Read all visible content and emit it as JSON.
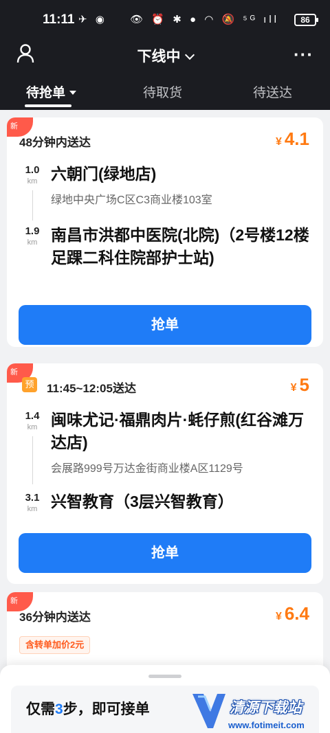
{
  "status_bar": {
    "time": "11:11",
    "left_icons": "✈ ◉",
    "right_icons": "👁 ⏰ ✱ ● ◠ 🔕 ⁵ᴳ ıll",
    "battery": "86"
  },
  "header": {
    "title": "下线中",
    "icons": [
      "user-icon",
      "chevron-down-icon",
      "more-icon"
    ],
    "more": "···"
  },
  "tabs": [
    {
      "label": "待抢单",
      "active": true
    },
    {
      "label": "待取货",
      "active": false
    },
    {
      "label": "待送达",
      "active": false
    }
  ],
  "orders": [
    {
      "badge": "新",
      "eta": "48分钟内送达",
      "currency": "¥",
      "price": "4.1",
      "pickup": {
        "distance": "1.0",
        "unit": "km",
        "name": "六朝门(绿地店)",
        "address": "绿地中央广场C区C3商业楼103室"
      },
      "dropoff": {
        "distance": "1.9",
        "unit": "km",
        "name": "南昌市洪都中医院(北院)（2号楼12楼足踝二科住院部护士站)"
      },
      "button": "抢单"
    },
    {
      "badge": "新",
      "tag": "预",
      "eta": "11:45~12:05送达",
      "currency": "¥",
      "price": "5",
      "pickup": {
        "distance": "1.4",
        "unit": "km",
        "name": "闽味尤记·福鼎肉片·蚝仔煎(红谷滩万达店)",
        "address": "会展路999号万达金街商业楼A区1129号"
      },
      "dropoff": {
        "distance": "3.1",
        "unit": "km",
        "name": "兴智教育（3层兴智教育）"
      },
      "button": "抢单"
    },
    {
      "badge": "新",
      "eta": "36分钟内送达",
      "currency": "¥",
      "price": "6.4",
      "bonus": "含转单加价2元"
    }
  ],
  "bottom_sheet": {
    "prefix": "仅需",
    "highlight": "3",
    "suffix": "步，即可接单"
  },
  "watermark": {
    "title": "清源下载站",
    "url": "www.fotimeit.com"
  },
  "colors": {
    "header_bg": "#1b1c21",
    "accent_blue": "#1f7cf7",
    "price_orange": "#ff7a12",
    "new_badge": "#ff5a4a"
  }
}
